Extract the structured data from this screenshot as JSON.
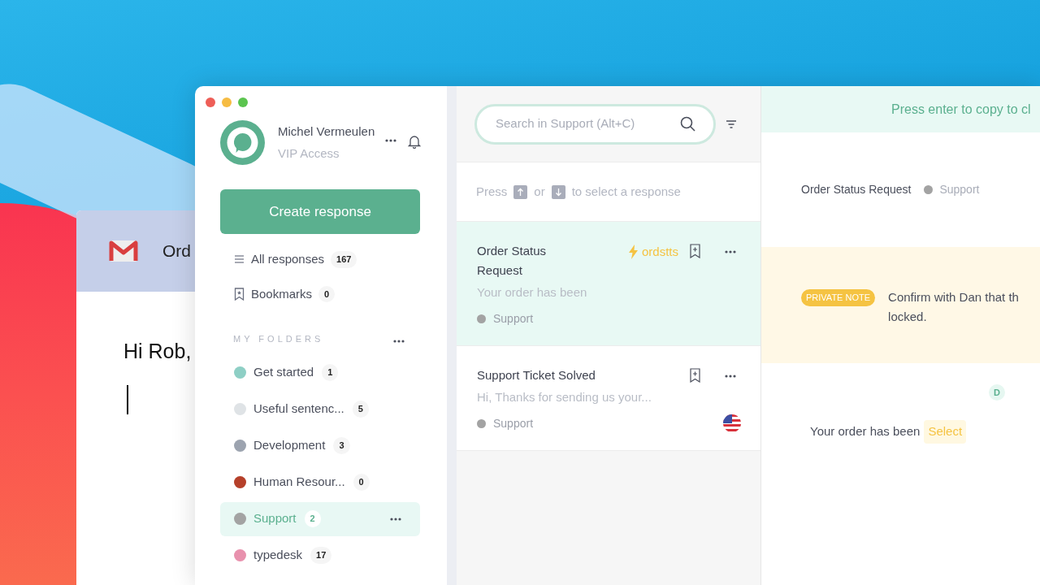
{
  "email_window": {
    "subject": "Ord",
    "greeting": "Hi Rob,"
  },
  "app": {
    "profile": {
      "name": "Michel Vermeulen",
      "plan": "VIP Access"
    },
    "create_button": "Create response",
    "nav": [
      {
        "kind": "list",
        "label": "All responses",
        "count": "167"
      },
      {
        "kind": "bookmark",
        "label": "Bookmarks",
        "count": "0"
      }
    ],
    "folders_heading": "MY FOLDERS",
    "folders": [
      {
        "label": "Get started",
        "count": "1",
        "color": "#8ecfc5",
        "selected": false
      },
      {
        "label": "Useful sentenc...",
        "count": "5",
        "color": "#dfe3e6",
        "selected": false
      },
      {
        "label": "Development",
        "count": "3",
        "color": "#9ca3af",
        "selected": false
      },
      {
        "label": "Human Resour...",
        "count": "0",
        "color": "#b5402a",
        "selected": false
      },
      {
        "label": "Support",
        "count": "2",
        "color": "#a3a3a3",
        "selected": true
      },
      {
        "label": "typedesk",
        "count": "17",
        "color": "#e891ad",
        "selected": false
      }
    ],
    "search": {
      "placeholder": "Search in Support (Alt+C)"
    },
    "hint": {
      "before": "Press",
      "middle": "or",
      "after": "to select a response"
    },
    "responses": [
      {
        "title": "Order Status Request",
        "shortcut": "ordstts",
        "preview": "Your order has been",
        "folder": "Support",
        "selected": true,
        "flag": false
      },
      {
        "title": "Support Ticket Solved",
        "preview": "Hi, Thanks for sending us your...",
        "folder": "Support",
        "selected": false,
        "flag": true
      }
    ],
    "detail": {
      "banner": "Press enter to copy to cl",
      "title": "Order Status Request",
      "folder": "Support",
      "note_badge": "PRIVATE NOTE",
      "note_lines": [
        "Confirm with Dan that th",
        "locked."
      ],
      "avatar": "D",
      "body": "Your order has been",
      "variable": "Select"
    }
  }
}
